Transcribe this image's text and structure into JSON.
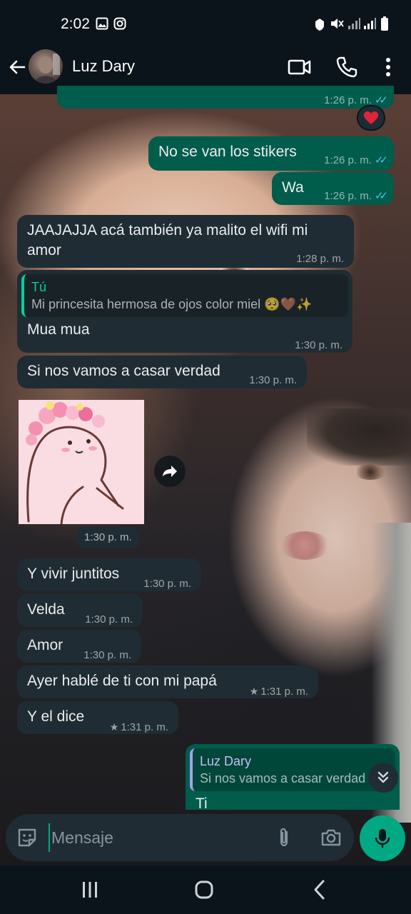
{
  "status_bar": {
    "time": "2:02"
  },
  "header": {
    "contact_name": "Luz Dary"
  },
  "reaction": "❤️",
  "messages": [
    {
      "text": "No se van los stikers",
      "time": "1:26 p. m."
    },
    {
      "text": "Wa",
      "time": "1:26 p. m."
    },
    {
      "text_line1": "JAAJAJJA acá también ya malito el wifi mi",
      "text_line2": "amor",
      "time": "1:28 p. m."
    },
    {
      "quote_author": "Tú",
      "quote_text": "Mi princesita hermosa de ojos color miel 🥺🤎✨",
      "text": "Mua mua",
      "time": "1:30 p. m."
    },
    {
      "text": "Si nos vamos a casar verdad",
      "time": "1:30 p. m."
    },
    {
      "time": "1:30 p. m."
    },
    {
      "text": "Y vivir juntitos",
      "time": "1:30 p. m."
    },
    {
      "text": "Velda",
      "time": "1:30 p. m."
    },
    {
      "text": "Amor",
      "time": "1:30 p. m."
    },
    {
      "text": "Ayer hablé de ti con mi papá",
      "time": "1:31 p. m."
    },
    {
      "text": "Y el dice",
      "time": "1:31 p. m."
    },
    {
      "quote_author": "Luz Dary",
      "quote_text": "Si nos vamos a casar verdad",
      "text": "Ti"
    }
  ],
  "top_partial_time": "1:26 p. m.",
  "composer": {
    "placeholder": "Mensaje"
  },
  "colors": {
    "incoming": "#202c33",
    "outgoing": "#005c4b",
    "accent": "#00a884",
    "ticks": "#53bdeb"
  },
  "icons": [
    "back-arrow-icon",
    "video-call-icon",
    "phone-icon",
    "more-vert-icon",
    "sticker-icon",
    "attach-icon",
    "camera-icon",
    "mic-icon",
    "forward-icon",
    "chevron-double-down-icon"
  ]
}
